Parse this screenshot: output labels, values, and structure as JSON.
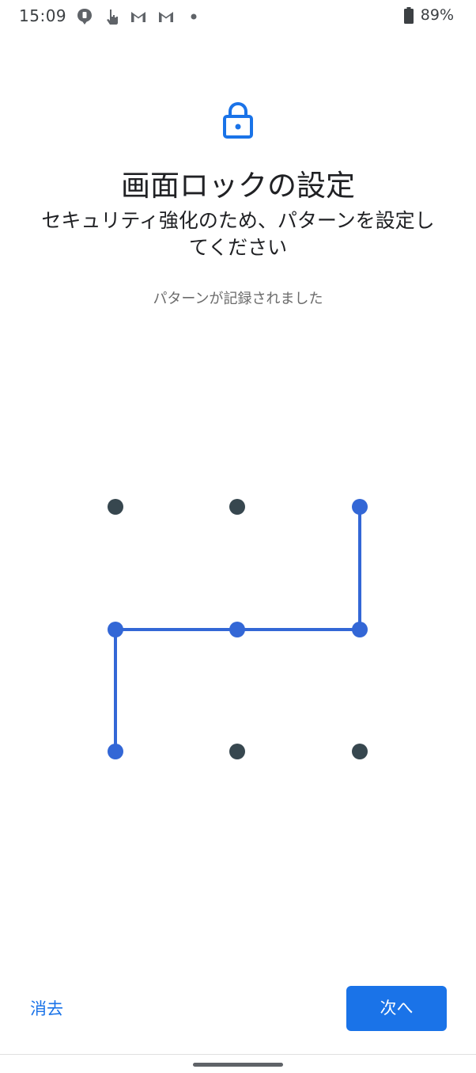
{
  "status_bar": {
    "time": "15:09",
    "battery": "89%",
    "icons": [
      "notification-dot-icon",
      "touch-icon",
      "gmail-icon",
      "gmail-icon",
      "dot-icon"
    ]
  },
  "header": {
    "lock_icon": "lock-icon",
    "title": "画面ロックの設定",
    "subtitle": "セキュリティ強化のため、パターンを設定してください",
    "status_message": "パターンが記録されました"
  },
  "pattern": {
    "grid": "3x3",
    "selected_sequence": [
      3,
      6,
      5,
      4,
      7
    ],
    "active_color": "#3367d6",
    "inactive_color": "#37474f"
  },
  "buttons": {
    "clear_label": "消去",
    "next_label": "次へ"
  },
  "colors": {
    "accent": "#1a73e8"
  }
}
